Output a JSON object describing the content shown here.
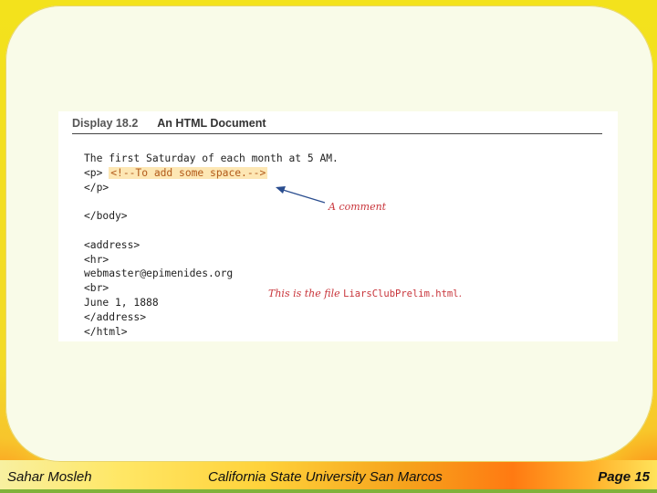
{
  "figure": {
    "number": "Display 18.2",
    "title": "An HTML Document",
    "code_lines": [
      "The first Saturday of each month at 5 AM.",
      "<p> ",
      "</p>",
      "",
      "</body>",
      "",
      "<address>",
      "<hr>",
      "webmaster@epimenides.org",
      "<br>",
      "June 1, 1888",
      "</address>",
      "</html>"
    ],
    "comment_code": "<!--To add some space.-->",
    "annotation_comment": "A comment",
    "annotation_file_prefix": "This is the file ",
    "annotation_file_name": "LiarsClubPrelim.html",
    "annotation_file_suffix": "."
  },
  "footer": {
    "author": "Sahar Mosleh",
    "institution": "California State University San Marcos",
    "page_label": "Page",
    "page_number": "15"
  },
  "colors": {
    "highlight": "#fde7b4",
    "annotation": "#c8343a"
  }
}
